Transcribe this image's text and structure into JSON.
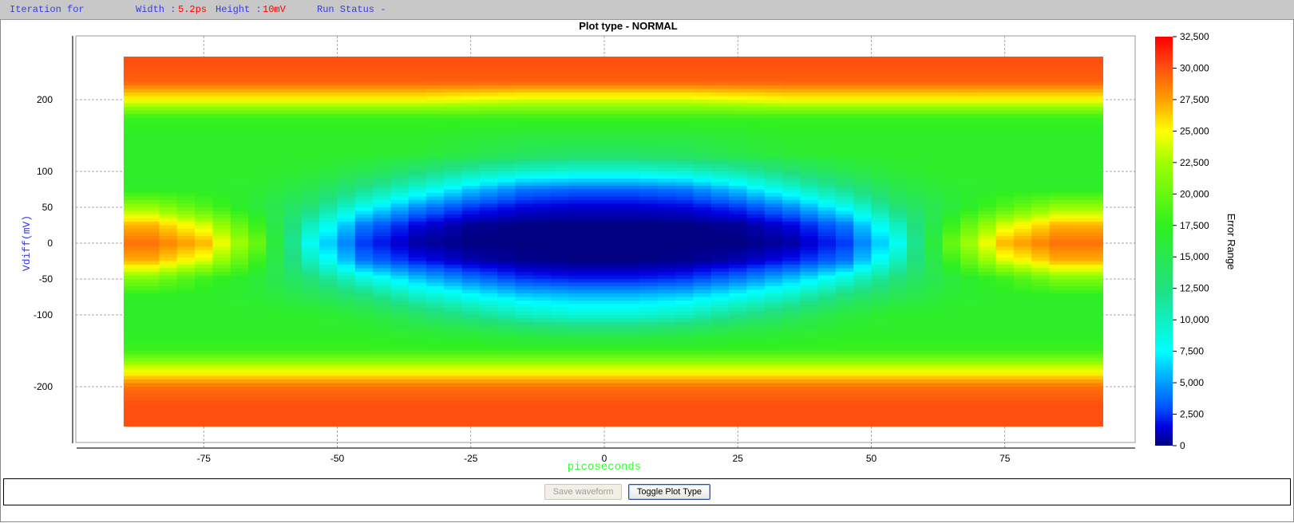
{
  "status_bar": {
    "iteration_label": "Iteration for",
    "width_label": "Width :",
    "width_value": "5.2ps",
    "height_label": "Height :",
    "height_value": "10mV",
    "run_status_label": "Run Status -"
  },
  "buttons": {
    "save_waveform": "Save waveform",
    "toggle_plot_type": "Toggle Plot Type"
  },
  "chart_data": {
    "type": "heatmap",
    "title": "Plot type - NORMAL",
    "xlabel": "picoseconds",
    "ylabel": "Vdiff(mV)",
    "colorbar_label": "Error Range",
    "xlim": [
      -100,
      99
    ],
    "ylim": [
      -285,
      285
    ],
    "x_ticks": [
      -75,
      -50,
      -25,
      0,
      25,
      50,
      75
    ],
    "x_tick_labels": [
      "-75",
      "-50",
      "-25",
      "0",
      "25",
      "50",
      "75"
    ],
    "y_ticks": [
      200,
      100,
      50,
      0,
      -50,
      -100,
      -200
    ],
    "y_tick_labels": [
      "200",
      "100",
      "50",
      "0",
      "-50",
      "-100",
      "-200"
    ],
    "colorbar_range": [
      0,
      32500
    ],
    "colorbar_ticks": [
      0,
      2500,
      5000,
      7500,
      10000,
      12500,
      15000,
      17500,
      20000,
      22500,
      25000,
      27500,
      30000,
      32500
    ],
    "colorbar_tick_labels": [
      "0",
      "2,500",
      "5,000",
      "7,500",
      "10,000",
      "12,500",
      "15,000",
      "17,500",
      "20,000",
      "22,500",
      "25,000",
      "27,500",
      "30,000",
      "32,500"
    ],
    "colormap": [
      "#000080",
      "#0000e0",
      "#0050ff",
      "#00ffff",
      "#20e080",
      "#30f020",
      "#a0ff00",
      "#ffff00",
      "#ffa000",
      "#ff5010",
      "#ff0000"
    ],
    "grid": true,
    "x": [
      -85,
      -75,
      -65,
      -55,
      -45,
      -35,
      -25,
      -15,
      -5,
      5,
      15,
      25,
      35,
      45,
      55,
      65,
      75,
      85
    ],
    "y": [
      250,
      225,
      200,
      175,
      150,
      125,
      100,
      75,
      50,
      25,
      0,
      -25,
      -50,
      -75,
      -100,
      -125,
      -150,
      -175,
      -200,
      -225,
      -250
    ],
    "values": [
      [
        30000,
        30000,
        30000,
        30000,
        30000,
        30000,
        30000,
        30000,
        30000,
        30000,
        30000,
        30000,
        30000,
        30000,
        30000,
        30000,
        30000,
        30000
      ],
      [
        29500,
        29500,
        29500,
        29500,
        29500,
        29500,
        29500,
        29500,
        29500,
        29500,
        29500,
        29500,
        29500,
        29500,
        29500,
        29500,
        29500,
        29500
      ],
      [
        25000,
        25000,
        25000,
        25000,
        25000,
        25000,
        24500,
        24000,
        24000,
        24000,
        24000,
        24500,
        25000,
        25000,
        25000,
        25000,
        25000,
        25000
      ],
      [
        18000,
        18000,
        18000,
        18000,
        18000,
        18000,
        18000,
        18000,
        18000,
        18000,
        18000,
        18000,
        18000,
        18000,
        18000,
        18000,
        18000,
        18000
      ],
      [
        17000,
        17000,
        17000,
        17000,
        17000,
        17000,
        16500,
        16000,
        16000,
        16000,
        16000,
        16500,
        17000,
        17000,
        17000,
        17000,
        17000,
        17000
      ],
      [
        17000,
        17000,
        17000,
        17000,
        17000,
        16500,
        15500,
        14500,
        14000,
        14000,
        14500,
        15500,
        16500,
        17000,
        17000,
        17000,
        17000,
        17000
      ],
      [
        17000,
        17000,
        17000,
        16500,
        15000,
        13000,
        11000,
        9500,
        9000,
        9000,
        9500,
        11000,
        13000,
        15000,
        16500,
        17000,
        17000,
        17000
      ],
      [
        17000,
        17000,
        16500,
        15000,
        12000,
        9000,
        6000,
        4000,
        3500,
        3500,
        4000,
        6000,
        9000,
        12000,
        15000,
        16500,
        17000,
        17000
      ],
      [
        22000,
        19000,
        16000,
        13000,
        8000,
        4500,
        2500,
        1500,
        1200,
        1200,
        1500,
        2500,
        4500,
        8000,
        13000,
        16000,
        19000,
        22000
      ],
      [
        27000,
        24000,
        18000,
        10000,
        4000,
        1500,
        300,
        0,
        0,
        0,
        0,
        300,
        1500,
        4000,
        10000,
        18000,
        24000,
        27000
      ],
      [
        29000,
        27000,
        20000,
        8000,
        2500,
        500,
        0,
        0,
        0,
        0,
        0,
        0,
        500,
        2500,
        8000,
        20000,
        27000,
        29000
      ],
      [
        27000,
        24000,
        18000,
        10000,
        4000,
        2000,
        800,
        200,
        0,
        0,
        200,
        800,
        2000,
        4000,
        10000,
        18000,
        24000,
        27000
      ],
      [
        21000,
        18000,
        16000,
        13000,
        9000,
        6000,
        4000,
        2500,
        2000,
        2000,
        2500,
        4000,
        6000,
        9000,
        13000,
        16000,
        18000,
        21000
      ],
      [
        17000,
        17000,
        16500,
        15000,
        13000,
        10000,
        8000,
        6500,
        6000,
        6000,
        6500,
        8000,
        10000,
        13000,
        15000,
        16500,
        17000,
        17000
      ],
      [
        17000,
        17000,
        17000,
        17000,
        16000,
        14000,
        12000,
        10000,
        9000,
        9000,
        10000,
        12000,
        14000,
        16000,
        17000,
        17000,
        17000,
        17000
      ],
      [
        17000,
        17000,
        17000,
        17000,
        17000,
        16500,
        16000,
        15000,
        14500,
        14500,
        15000,
        16000,
        16500,
        17000,
        17000,
        17000,
        17000,
        17000
      ],
      [
        18000,
        18000,
        18000,
        18000,
        18000,
        18000,
        18000,
        18000,
        18000,
        18000,
        18000,
        18000,
        18000,
        18000,
        18000,
        18000,
        18000,
        18000
      ],
      [
        24000,
        24000,
        24000,
        24000,
        24000,
        24000,
        24000,
        24000,
        24000,
        24000,
        24000,
        24000,
        24000,
        24000,
        24000,
        24000,
        24000,
        24000
      ],
      [
        29000,
        29000,
        29000,
        29000,
        29000,
        29000,
        29000,
        29000,
        29000,
        29000,
        29000,
        29000,
        29000,
        29000,
        29000,
        29000,
        29000,
        29000
      ],
      [
        30000,
        30000,
        30000,
        30000,
        30000,
        30000,
        30000,
        30000,
        30000,
        30000,
        30000,
        30000,
        30000,
        30000,
        30000,
        30000,
        30000,
        30000
      ],
      [
        30000,
        30000,
        30000,
        30000,
        30000,
        30000,
        30000,
        30000,
        30000,
        30000,
        30000,
        30000,
        30000,
        30000,
        30000,
        30000,
        30000,
        30000
      ]
    ]
  }
}
